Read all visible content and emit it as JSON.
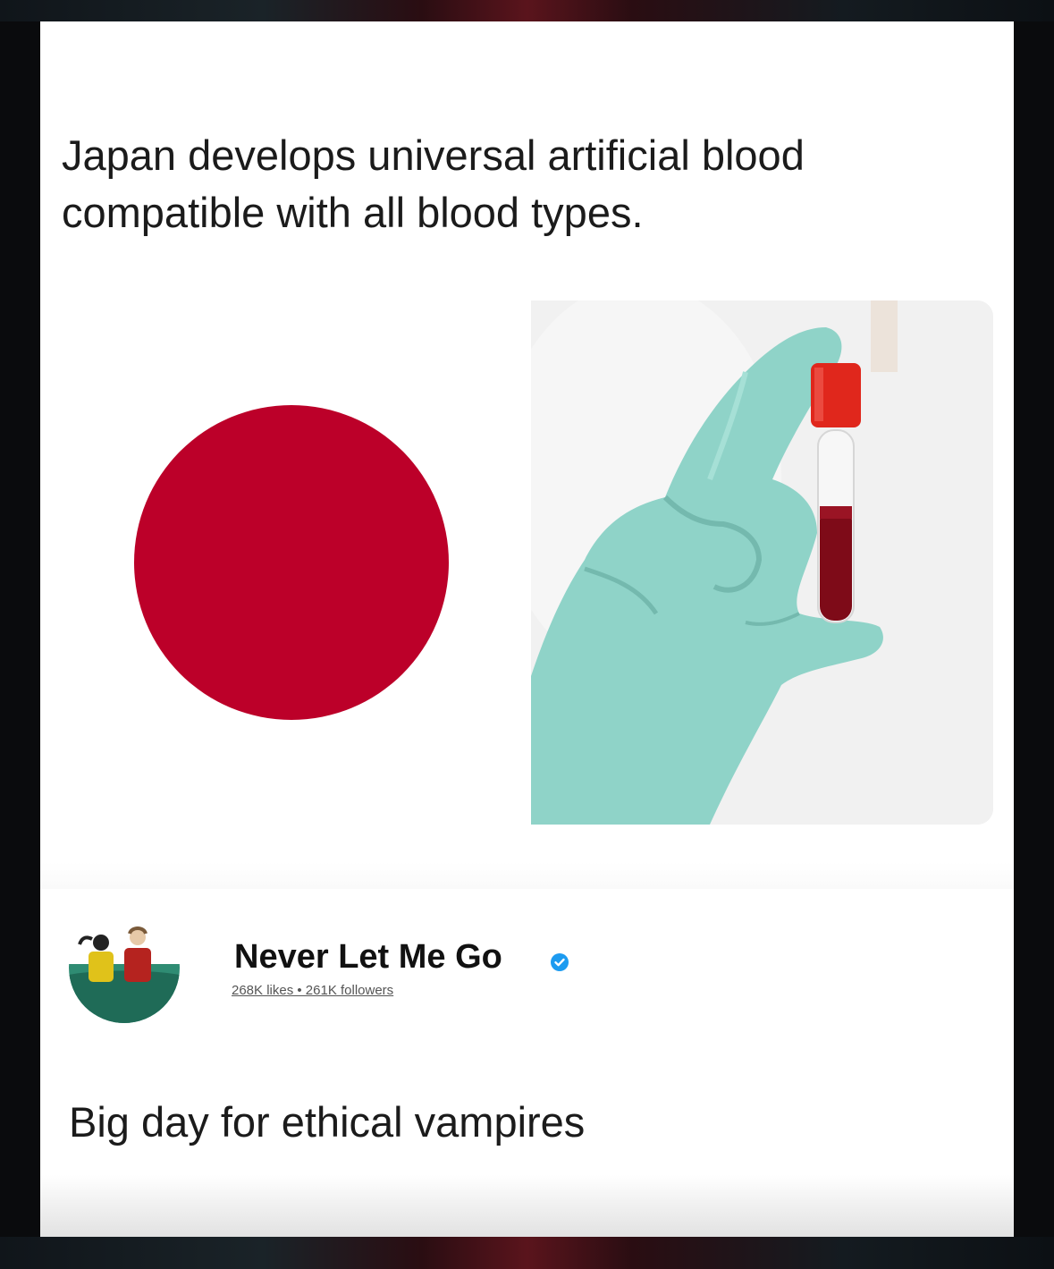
{
  "post": {
    "headline": "Japan develops universal artificial blood compatible with all blood types.",
    "caption": "Big day for ethical vampires"
  },
  "profile": {
    "name": "Never Let Me Go",
    "verified": true,
    "stats": "268K likes • 261K followers"
  },
  "colors": {
    "disc_red": "#bc0029",
    "glove": "#8fd3c8",
    "tube_cap": "#e0271c",
    "blood": "#7e0b18",
    "verified_blue": "#1d9bf0"
  },
  "icons": {
    "badge": "verified-check-icon"
  }
}
